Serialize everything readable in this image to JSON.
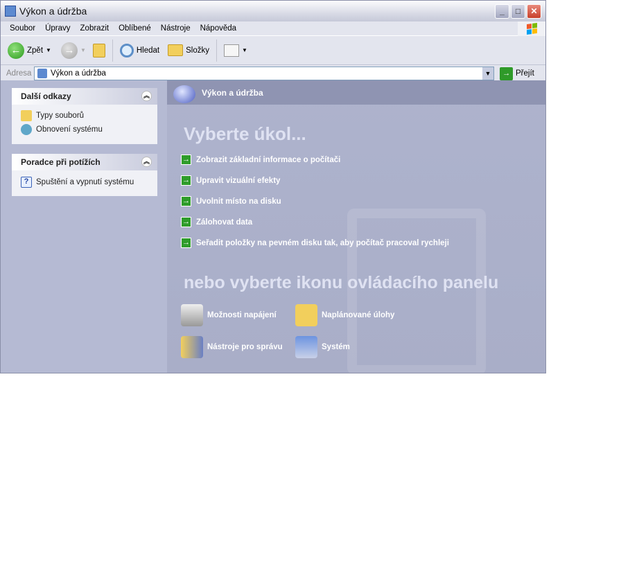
{
  "window": {
    "title": "Výkon a údržba",
    "minimize": "_",
    "maximize": "□",
    "close": "✕"
  },
  "menu": [
    "Soubor",
    "Úpravy",
    "Zobrazit",
    "Oblíbené",
    "Nástroje",
    "Nápověda"
  ],
  "toolbar": {
    "back": "Zpět",
    "search": "Hledat",
    "folders": "Složky"
  },
  "address": {
    "label": "Adresa",
    "value": "Výkon a údržba",
    "go": "Přejít"
  },
  "sidebar": [
    {
      "title": "Další odkazy",
      "items": [
        "Typy souborů",
        "Obnovení systému"
      ]
    },
    {
      "title": "Poradce při potížích",
      "items": [
        "Spuštění a vypnutí systému"
      ]
    }
  ],
  "main": {
    "header": "Výkon a údržba",
    "pick_task": "Vyberte úkol...",
    "tasks": [
      "Zobrazit základní informace o počítači",
      "Upravit vizuální efekty",
      "Uvolnit místo na disku",
      "Zálohovat data",
      "Seřadit položky na pevném disku tak, aby počítač pracoval rychleji"
    ],
    "pick_icon": "nebo vyberte ikonu ovládacího panelu",
    "icons": [
      "Možnosti napájení",
      "Naplánované úlohy",
      "Nástroje pro správu",
      "Systém"
    ]
  }
}
